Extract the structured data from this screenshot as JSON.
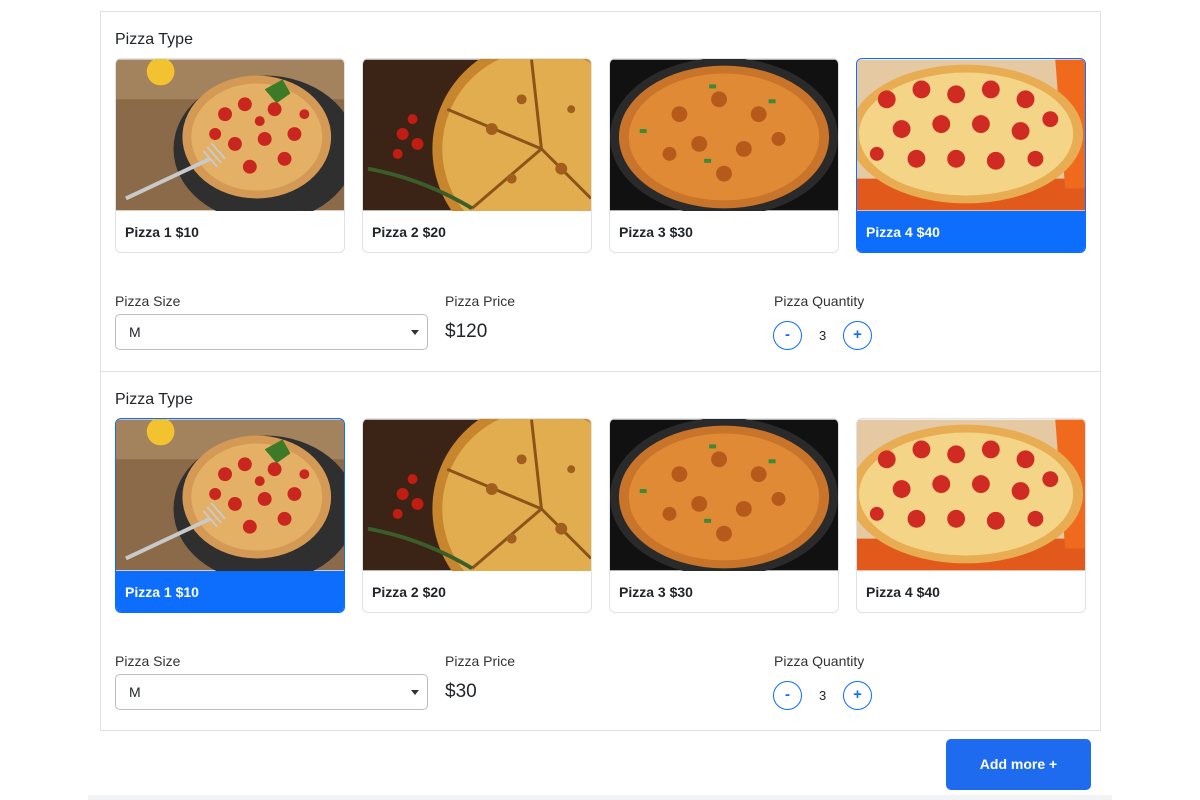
{
  "orders": [
    {
      "type_title": "Pizza Type",
      "pizzas": [
        {
          "label": "Pizza 1 $10",
          "selected": false
        },
        {
          "label": "Pizza 2 $20",
          "selected": false
        },
        {
          "label": "Pizza 3 $30",
          "selected": false
        },
        {
          "label": "Pizza 4 $40",
          "selected": true
        }
      ],
      "size_label": "Pizza Size",
      "size_value": "M",
      "price_label": "Pizza Price",
      "price_value": "$120",
      "quantity_label": "Pizza Quantity",
      "minus_label": "-",
      "plus_label": "+",
      "quantity_value": "3"
    },
    {
      "type_title": "Pizza Type",
      "pizzas": [
        {
          "label": "Pizza 1 $10",
          "selected": true
        },
        {
          "label": "Pizza 2 $20",
          "selected": false
        },
        {
          "label": "Pizza 3 $30",
          "selected": false
        },
        {
          "label": "Pizza 4 $40",
          "selected": false
        }
      ],
      "size_label": "Pizza Size",
      "size_value": "M",
      "price_label": "Pizza Price",
      "price_value": "$30",
      "quantity_label": "Pizza Quantity",
      "minus_label": "-",
      "plus_label": "+",
      "quantity_value": "3"
    }
  ],
  "add_more_label": "Add more +",
  "colors": {
    "accent": "#0d6efd",
    "button": "#1f6bf0"
  }
}
